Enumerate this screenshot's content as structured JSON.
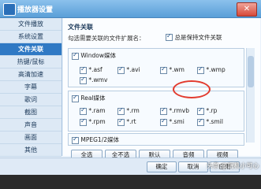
{
  "window": {
    "title": "播放器设置",
    "close": "✕"
  },
  "sidebar": {
    "items": [
      {
        "label": "文件播放"
      },
      {
        "label": "系统设置"
      },
      {
        "label": "文件关联"
      },
      {
        "label": "热键/鼠标"
      },
      {
        "label": "高清加速"
      },
      {
        "label": "字幕"
      },
      {
        "label": "歌词"
      },
      {
        "label": "截图"
      },
      {
        "label": "声音"
      },
      {
        "label": "画面"
      },
      {
        "label": "其他"
      }
    ],
    "active_index": 2
  },
  "content": {
    "section_title": "文件关联",
    "hint": "勾选需要关联的文件扩展名：",
    "always_keep_label": "总是保持文件关联",
    "groups": [
      {
        "label": "Window媒体",
        "options": [
          {
            "label": "*.asf"
          },
          {
            "label": "*.avi"
          },
          {
            "label": "*.wm"
          },
          {
            "label": "*.wmp"
          },
          {
            "label": "*.wmv"
          }
        ]
      },
      {
        "label": "Real媒体",
        "options": [
          {
            "label": "*.ram"
          },
          {
            "label": "*.rm"
          },
          {
            "label": "*.rmvb"
          },
          {
            "label": "*.rp"
          },
          {
            "label": "*.rpm"
          },
          {
            "label": "*.rt"
          },
          {
            "label": "*.smi"
          },
          {
            "label": "*.smil"
          }
        ]
      },
      {
        "label": "MPEG1/2媒体"
      }
    ],
    "buttons": [
      "全选",
      "全不选",
      "默认",
      "音频",
      "视频"
    ]
  },
  "footer": {
    "ok": "确定",
    "cancel": "取消",
    "apply": "应用"
  },
  "watermark": "头条 @玩机小可心"
}
